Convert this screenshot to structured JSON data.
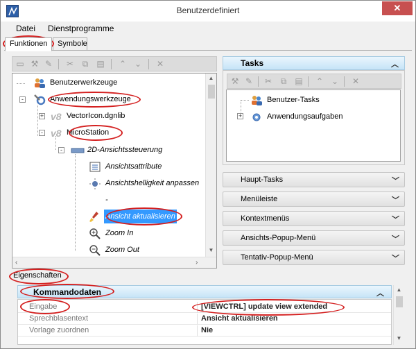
{
  "window": {
    "title": "Benutzerdefiniert",
    "close_glyph": "✕"
  },
  "menu": [
    {
      "label": "Datei",
      "accel": "D"
    },
    {
      "label": "Dienstprogramme",
      "accel": "D"
    }
  ],
  "tabs": [
    {
      "label": "Funktionen",
      "active": true
    },
    {
      "label": "Symbole",
      "active": false
    }
  ],
  "left_toolbar_icons": [
    "line-icon",
    "wrench-icon",
    "wrench-edit-icon",
    "cut-icon",
    "copy-icon",
    "paste-icon",
    "arrow-up-icon",
    "arrow-down-icon",
    "delete-icon"
  ],
  "left_tree": [
    {
      "label": "Benutzerwerkzeuge",
      "icon": "users-icon",
      "level": 0,
      "expander": ""
    },
    {
      "label": "Anwendungswerkzeuge",
      "icon": "tools-gear-icon",
      "level": 0,
      "expander": "-"
    },
    {
      "label": "VectorIcon.dgnlib",
      "icon": "v8-icon",
      "level": 1,
      "expander": "+"
    },
    {
      "label": "MicroStation",
      "icon": "v8-icon",
      "level": 1,
      "expander": "-"
    },
    {
      "label": "2D-Ansichtssteuerung",
      "icon": "toolbox-icon",
      "level": 2,
      "expander": "-",
      "italic": true
    },
    {
      "label": "Ansichtsattribute",
      "icon": "view-attributes-icon",
      "level": 3,
      "italic": true
    },
    {
      "label": "Ansichtshelligkeit anpassen",
      "icon": "brightness-icon",
      "level": 3,
      "italic": true
    },
    {
      "label": "-",
      "icon": "",
      "level": 3,
      "italic": true
    },
    {
      "label": "Ansicht aktualisieren",
      "icon": "update-view-brush-icon",
      "level": 3,
      "italic": true,
      "selected": true
    },
    {
      "label": "Zoom In",
      "icon": "zoom-in-icon",
      "level": 3,
      "italic": true
    },
    {
      "label": "Zoom Out",
      "icon": "zoom-out-icon",
      "level": 3,
      "italic": true
    }
  ],
  "tasks": {
    "header": "Tasks",
    "toolbar_icons": [
      "wrench-icon",
      "wrench-edit-icon",
      "cut-icon",
      "copy-icon",
      "paste-icon",
      "arrow-up-icon",
      "arrow-down-icon",
      "delete-icon"
    ],
    "tree": [
      {
        "label": "Benutzer-Tasks",
        "icon": "users-icon",
        "expander": ""
      },
      {
        "label": "Anwendungsaufgaben",
        "icon": "tasks-gear-icon",
        "expander": "+"
      }
    ]
  },
  "accordion": [
    {
      "label": "Haupt-Tasks"
    },
    {
      "label": "Menüleiste"
    },
    {
      "label": "Kontextmenüs"
    },
    {
      "label": "Ansichts-Popup-Menü"
    },
    {
      "label": "Tentativ-Popup-Menü"
    }
  ],
  "properties": {
    "label": "Eigenschaften",
    "section": "Kommandodaten",
    "rows": [
      {
        "key": "Eingabe",
        "value": "[VIEWCTRL] update view extended"
      },
      {
        "key": "Sprechblasentext",
        "value": "Ansicht aktualisieren"
      },
      {
        "key": "Vorlage zuordnen",
        "value": "Nie"
      }
    ]
  },
  "colors": {
    "selection": "#3399ff",
    "annotation": "#d42020",
    "header_gradient_top": "#eaf6fd",
    "header_gradient_bottom": "#c6e4f7"
  }
}
